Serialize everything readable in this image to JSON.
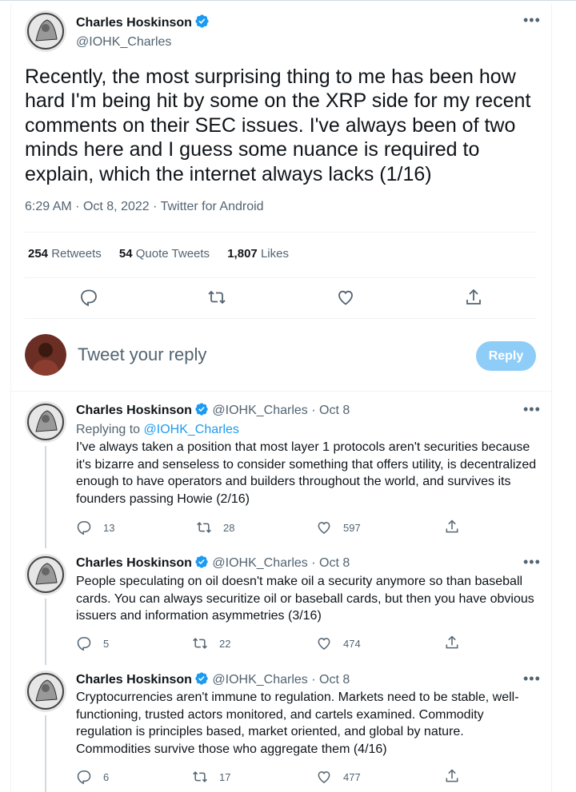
{
  "main_tweet": {
    "author_name": "Charles Hoskinson",
    "author_handle": "@IOHK_Charles",
    "text": "Recently, the most surprising thing to me has been how hard I'm being hit by some on the XRP side for my recent comments on their SEC issues. I've always been of two minds here and I guess some nuance is required to explain, which the internet always lacks (1/16)",
    "time": "6:29 AM",
    "date": "Oct 8, 2022",
    "source": "Twitter for Android",
    "stats": {
      "retweets_count": "254",
      "retweets_label": "Retweets",
      "quotes_count": "54",
      "quotes_label": "Quote Tweets",
      "likes_count": "1,807",
      "likes_label": "Likes"
    }
  },
  "reply_box": {
    "placeholder": "Tweet your reply",
    "button_label": "Reply"
  },
  "thread": [
    {
      "author_name": "Charles Hoskinson",
      "author_handle": "@IOHK_Charles",
      "date": "Oct 8",
      "replying_prefix": "Replying to",
      "replying_handle": "@IOHK_Charles",
      "text": "I've always taken a position that most layer 1 protocols aren't securities because it's bizarre and senseless to consider something that offers utility, is decentralized enough to have operators and builders throughout the world, and survives its founders passing Howie (2/16)",
      "replies": "13",
      "retweets": "28",
      "likes": "597"
    },
    {
      "author_name": "Charles Hoskinson",
      "author_handle": "@IOHK_Charles",
      "date": "Oct 8",
      "text": "People speculating on oil doesn't make oil a security anymore so than baseball cards. You can always securitize oil or baseball cards, but then you have obvious issuers and information asymmetries (3/16)",
      "replies": "5",
      "retweets": "22",
      "likes": "474"
    },
    {
      "author_name": "Charles Hoskinson",
      "author_handle": "@IOHK_Charles",
      "date": "Oct 8",
      "text": "Cryptocurrencies aren't immune to regulation. Markets need to be stable, well-functioning, trusted actors monitored, and cartels examined. Commodity regulation is principles based, market oriented, and global by nature. Commodities survive those who aggregate them (4/16)",
      "replies": "6",
      "retweets": "17",
      "likes": "477"
    }
  ],
  "colors": {
    "accent": "#1d9bf0",
    "reply_button": "#8ecdf8",
    "muted": "#536471",
    "text": "#0f1419"
  },
  "icons": [
    "verified-badge-icon",
    "more-dots-icon",
    "reply-icon",
    "retweet-icon",
    "like-icon",
    "share-icon"
  ]
}
